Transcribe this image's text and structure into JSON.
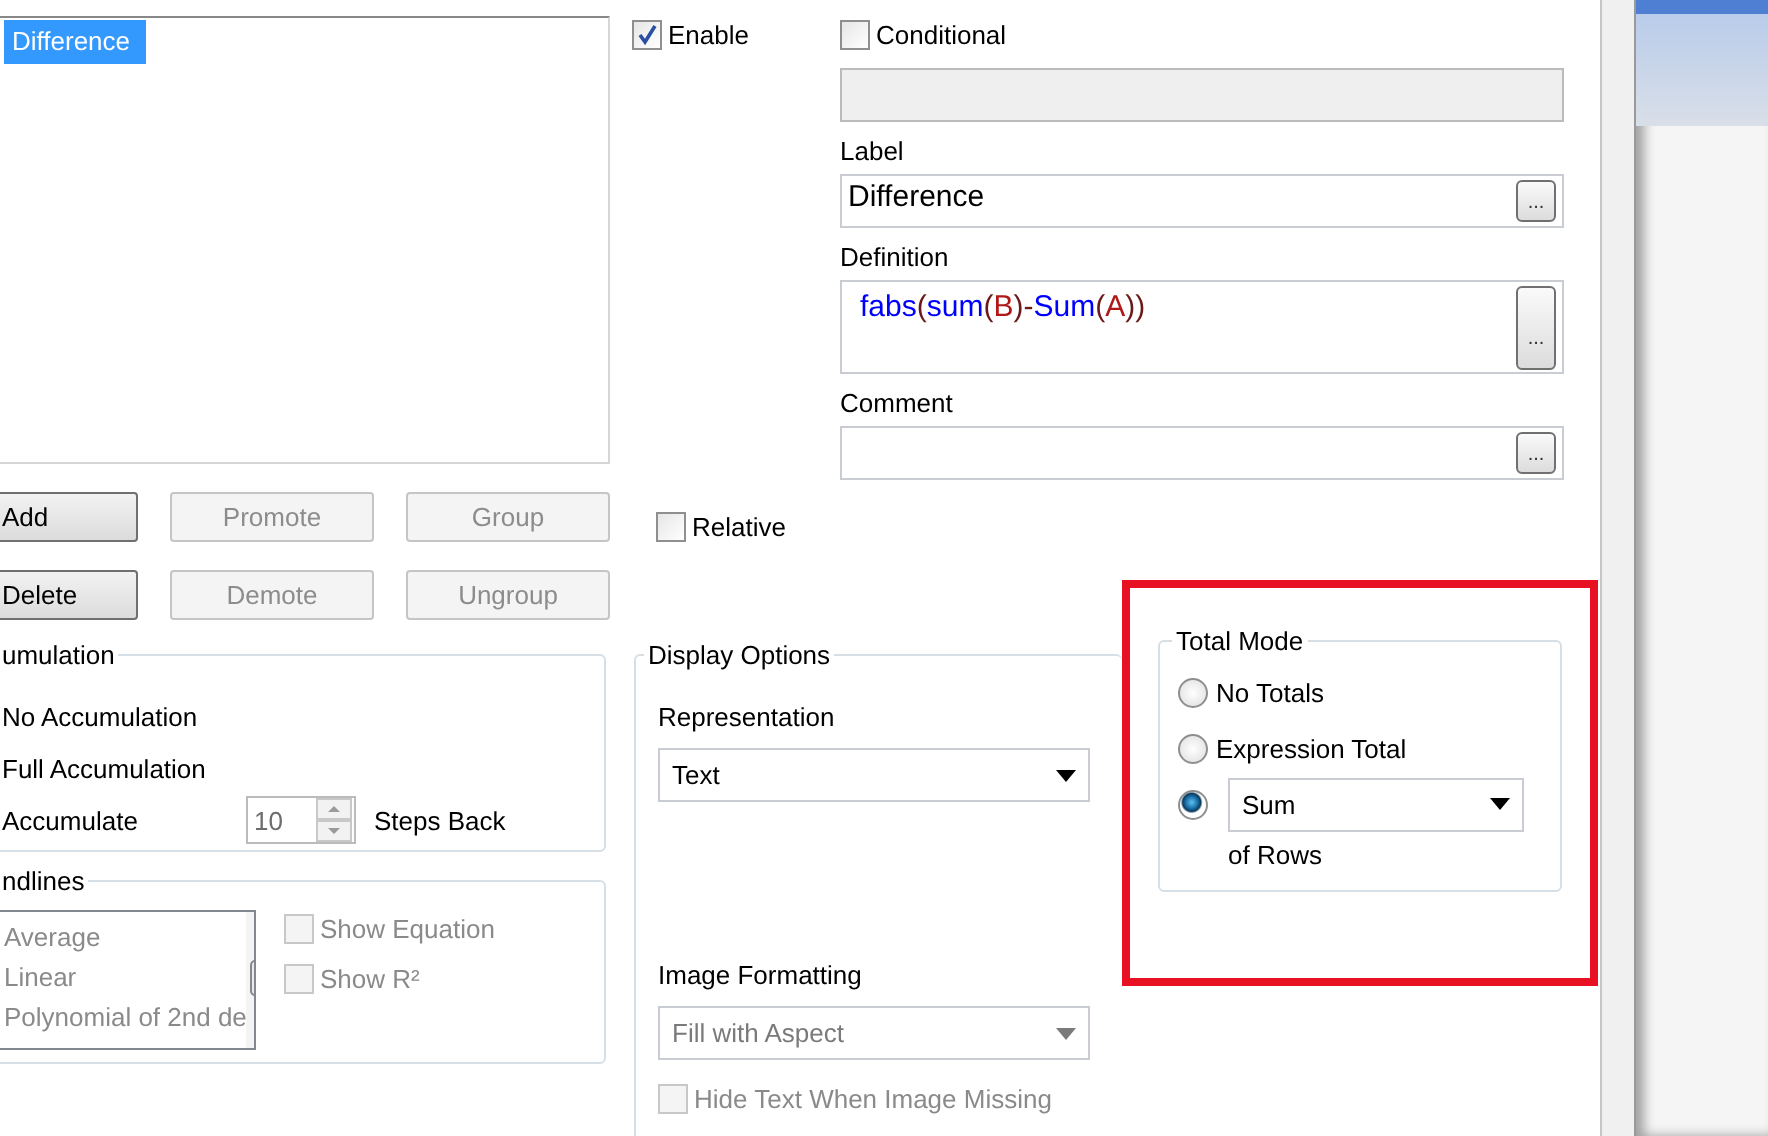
{
  "expressions_list": {
    "items": [
      {
        "label": "Difference",
        "selected": true
      }
    ]
  },
  "list_buttons": [
    {
      "label": "Add",
      "disabled": false
    },
    {
      "label": "Promote",
      "disabled": true
    },
    {
      "label": "Group",
      "disabled": true
    },
    {
      "label": "Delete",
      "disabled": false
    },
    {
      "label": "Demote",
      "disabled": true
    },
    {
      "label": "Ungroup",
      "disabled": true
    }
  ],
  "enable": {
    "label": "Enable",
    "checked": true
  },
  "conditional": {
    "label": "Conditional",
    "checked": false
  },
  "label_field": {
    "label": "Label",
    "value": "Difference",
    "button": "..."
  },
  "definition_field": {
    "label": "Definition",
    "button": "...",
    "tokens": [
      {
        "text": "fabs",
        "kind": "function"
      },
      {
        "text": "(",
        "kind": "punct"
      },
      {
        "text": "sum",
        "kind": "function"
      },
      {
        "text": "(",
        "kind": "punct"
      },
      {
        "text": "B",
        "kind": "field"
      },
      {
        "text": ")-",
        "kind": "punct"
      },
      {
        "text": "Sum",
        "kind": "function"
      },
      {
        "text": "(",
        "kind": "punct"
      },
      {
        "text": "A",
        "kind": "field"
      },
      {
        "text": "))",
        "kind": "punct"
      }
    ]
  },
  "comment_field": {
    "label": "Comment",
    "button": "..."
  },
  "relative": {
    "label": "Relative",
    "checked": false
  },
  "accumulation": {
    "title": "umulation",
    "options": [
      "No Accumulation",
      "Full Accumulation",
      "Accumulate"
    ],
    "steps": "10",
    "steps_label": "Steps Back"
  },
  "trendlines": {
    "title": "ndlines",
    "disabled": true,
    "items": [
      "Average",
      "Linear",
      "Polynomial of 2nd de"
    ],
    "checks": [
      {
        "label": "Show Equation",
        "checked": false,
        "disabled": true
      },
      {
        "label": "Show R²",
        "checked": false,
        "disabled": true
      }
    ]
  },
  "display_options": {
    "title": "Display Options",
    "representation": {
      "label": "Representation",
      "value": "Text",
      "disabled": false
    },
    "image_formatting": {
      "label": "Image Formatting",
      "value": "Fill with Aspect",
      "disabled": true
    },
    "hide_text": {
      "label": "Hide Text When Image Missing",
      "checked": false,
      "disabled": true
    }
  },
  "total_mode": {
    "title": "Total Mode",
    "options": [
      {
        "kind": "label",
        "label": "No Totals",
        "selected": false
      },
      {
        "kind": "label",
        "label": "Expression Total",
        "selected": false
      },
      {
        "kind": "dropdown",
        "value": "Sum",
        "selected": true
      }
    ],
    "suffix": "of Rows"
  }
}
